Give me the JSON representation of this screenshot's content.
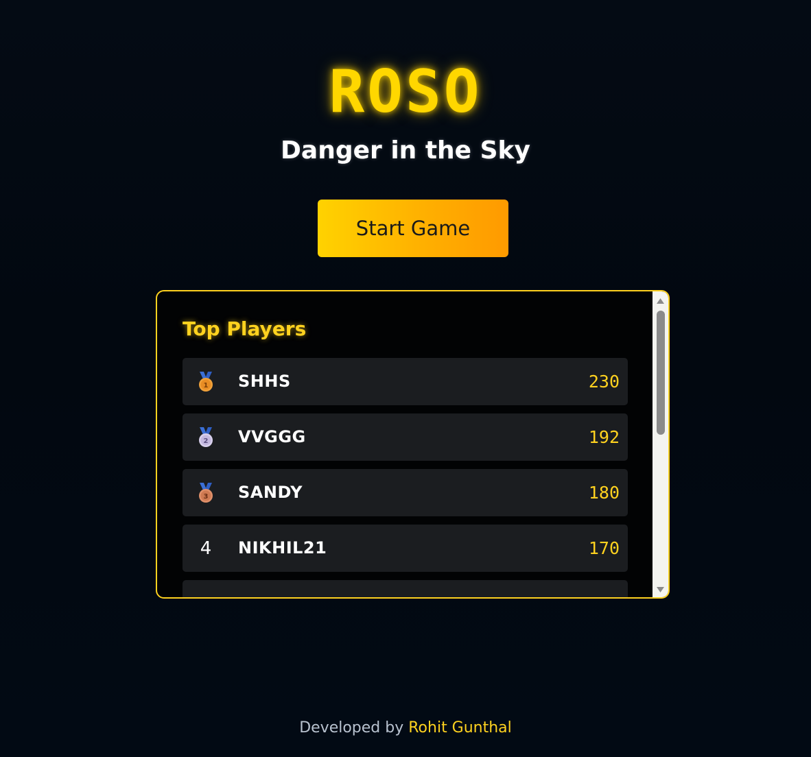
{
  "header": {
    "title": "ROSO",
    "subtitle": "Danger in the Sky"
  },
  "actions": {
    "start_label": "Start Game"
  },
  "leaderboard": {
    "title": "Top Players",
    "rows": [
      {
        "rank": "1",
        "medal_icon": "gold-medal-icon",
        "name": "SHHS",
        "score": "230"
      },
      {
        "rank": "2",
        "medal_icon": "silver-medal-icon",
        "name": "VVGGG",
        "score": "192"
      },
      {
        "rank": "3",
        "medal_icon": "bronze-medal-icon",
        "name": "SANDY",
        "score": "180"
      },
      {
        "rank": "4",
        "medal_icon": "",
        "name": "NIKHIL21",
        "score": "170"
      }
    ]
  },
  "footer": {
    "prefix": "Developed by ",
    "author": "Rohit Gunthal"
  },
  "colors": {
    "accent": "#ffd21f",
    "button_start": "#ffd200",
    "button_end": "#ff9a00",
    "row_bg": "#1b1d20",
    "background": "#020810"
  }
}
